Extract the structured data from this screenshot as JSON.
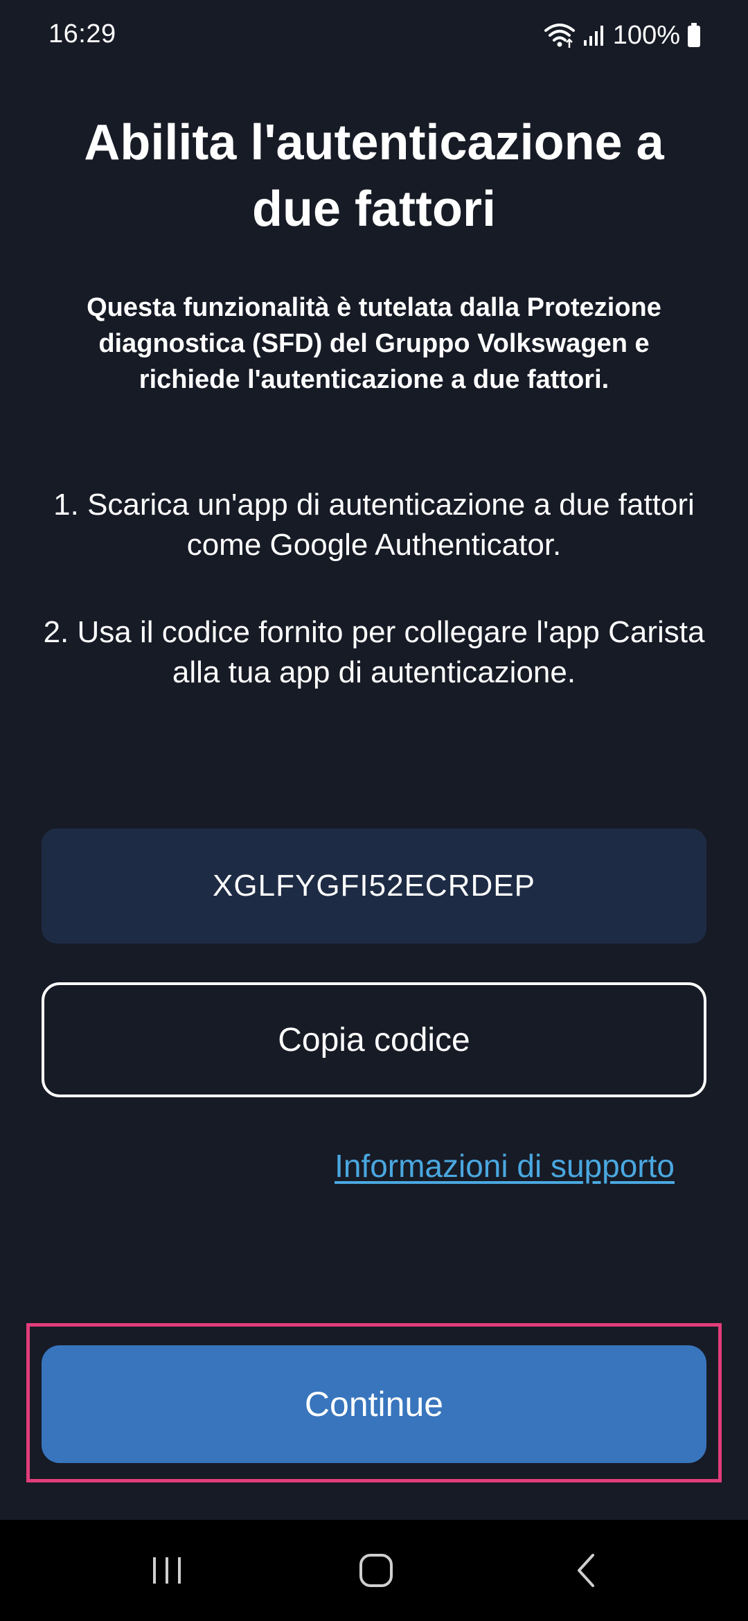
{
  "status_bar": {
    "time": "16:29",
    "battery": "100%",
    "icons": [
      "wifi-icon",
      "signal-icon",
      "battery-icon"
    ]
  },
  "main": {
    "title": "Abilita l'autenticazione a due fattori",
    "subtitle": "Questa funzionalità è tutelata dalla Protezione diagnostica (SFD) del Gruppo Volkswagen e richiede l'autenticazione a due fattori.",
    "step1": "1. Scarica un'app di autenticazione a due fattori come Google Authenticator.",
    "step2": "2. Usa il codice fornito per collegare l'app Carista alla tua app di autenticazione.",
    "code": "XGLFYGFI52ECRDEP",
    "copy_label": "Copia codice",
    "support_link": "Informazioni di supporto",
    "continue_label": "Continue"
  },
  "nav_bar": {
    "icons": [
      "recent-apps-icon",
      "home-icon",
      "back-icon"
    ]
  },
  "colors": {
    "background": "#171b26",
    "code_box": "#1e2b45",
    "link": "#4aa8e0",
    "primary_button": "#3875bd",
    "highlight": "#e33d7b"
  }
}
